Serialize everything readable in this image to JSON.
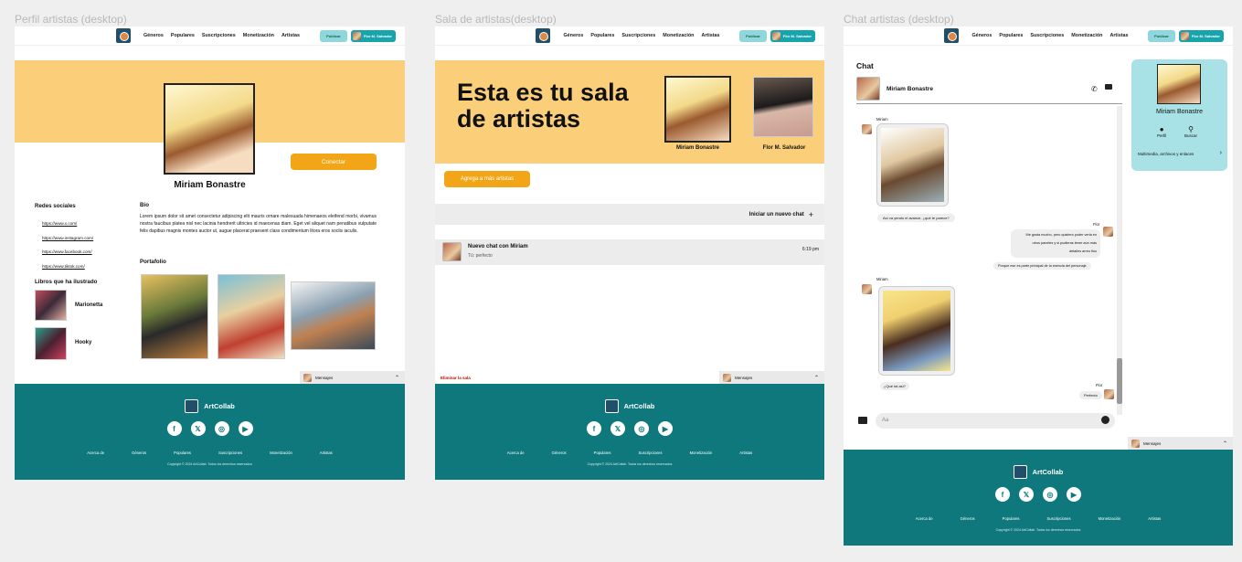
{
  "labels": {
    "perfil": "Perfil artistas (desktop)",
    "sala": "Sala de artistas(desktop)",
    "chat": "Chat artistas (desktop)"
  },
  "nav": {
    "links": [
      "Géneros",
      "Populares",
      "Suscripciones",
      "Monetización",
      "Artistas"
    ],
    "publish": "Publicar",
    "user": "Flor M. Salvador"
  },
  "profile": {
    "name": "Miriam Bonastre",
    "connect": "Conectar",
    "social_title": "Redes sociales",
    "socials": [
      "https://www.x.com/",
      "https://www.instagram.com/",
      "https://www.facebook.com/",
      "https://www.tiktok.com/"
    ],
    "bio_title": "Bio",
    "bio": "Lorem ipsum dolor sit amet consectetur adipiscing elit mauris ornare malesuada himenaeos eleifend morbi, vivamus nostra faucibus platea nisl nec lacinia hendrerit ultricies id maecenas diam. Eget vel aliquet nam penatibus vulputate felis dapibus magnis montes auctor ut, augue placerat praesent class condimentum litora eros sociis iaculis.",
    "books_title": "Libros que ha ilustrado",
    "books": [
      "Marionetta",
      "Hooky"
    ],
    "portfolio_title": "Portafolio"
  },
  "sala": {
    "title1": "Esta es tu sala",
    "title2": "de artistas",
    "artist1": "Miriam Bonastre",
    "artist2": "Flor M. Salvador",
    "add": "Agrega a más artistas",
    "new_chat": "Iniciar un nuevo chat",
    "plus": "+",
    "chat_title": "Nuevo chat con Miriam",
    "chat_sub": "Tú: perfecto",
    "chat_time": "6:19 pm",
    "delete": "Eliminar la sala"
  },
  "chat": {
    "title": "Chat",
    "contact": "Miriam Bonastre",
    "sender1": "Miriam",
    "msg1": "Así va yendo el avance, ¿qué te parece?",
    "sender2": "Flor",
    "msg2a": "Me gusta mucho, pero quisiera poder verla en",
    "msg2b": "otros paneles y si pudieras tener aún más",
    "msg2c": "detalles arreo flos",
    "msg3": "Porque ese es parte principal de la esencia del personaje",
    "sender3": "Miriam",
    "msg4": "¿Qué tal así?",
    "sender4": "Flor",
    "msg5": "Perfecto",
    "input": "Aa",
    "panel_name": "Miriam Bonastre",
    "perfil": "Perfil",
    "buscar": "Buscar",
    "media": "Multimedia, archivos y enlaces"
  },
  "messages": "Mensajes",
  "footer": {
    "brand": "ArtCollab",
    "links": [
      "Acerca de",
      "Géneros",
      "Populares",
      "Suscripciones",
      "Monetización",
      "Artistas"
    ],
    "copy": "Copyright © 2024 ArtCollab.   Todos los derechos reservados"
  },
  "colors": {
    "yellow": "#fbcf7a",
    "teal": "#0e787c",
    "orange": "#f2a516",
    "cyan": "#a8e2e6"
  }
}
